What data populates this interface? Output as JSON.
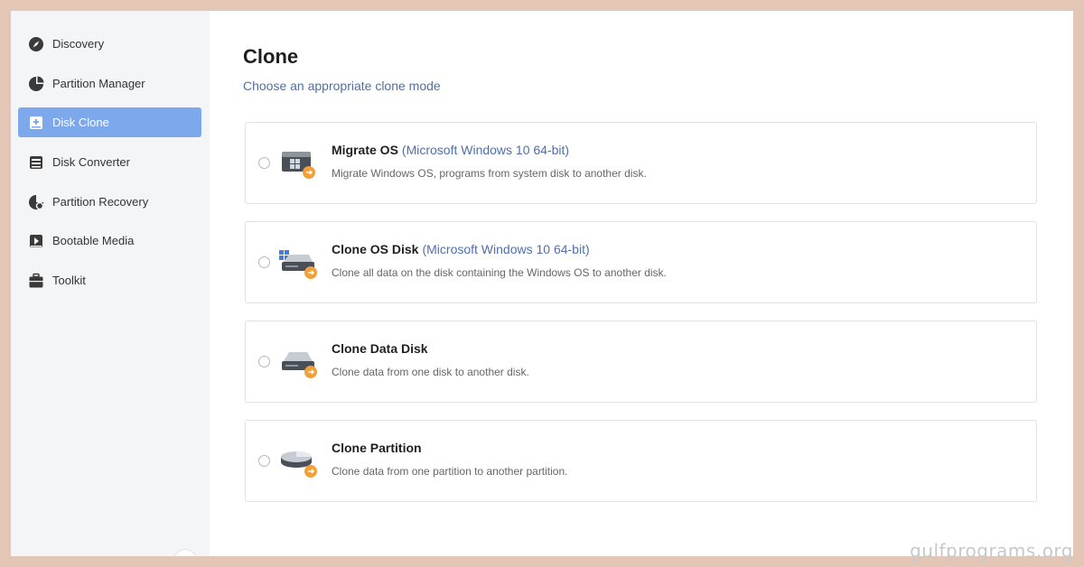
{
  "sidebar": {
    "items": [
      {
        "label": "Discovery",
        "icon": "compass-icon"
      },
      {
        "label": "Partition Manager",
        "icon": "pie-chart-icon"
      },
      {
        "label": "Disk Clone",
        "icon": "disk-clone-icon",
        "active": true
      },
      {
        "label": "Disk Converter",
        "icon": "disk-converter-icon"
      },
      {
        "label": "Partition Recovery",
        "icon": "partition-recovery-icon"
      },
      {
        "label": "Bootable Media",
        "icon": "bootable-media-icon"
      },
      {
        "label": "Toolkit",
        "icon": "toolkit-icon"
      }
    ]
  },
  "main": {
    "title": "Clone",
    "subtitle": "Choose an appropriate clone mode",
    "options": [
      {
        "title": "Migrate OS",
        "os": "(Microsoft Windows 10 64-bit)",
        "desc": "Migrate Windows OS, programs from system disk to another disk.",
        "icon": "migrate-os-icon"
      },
      {
        "title": "Clone OS Disk",
        "os": "(Microsoft Windows 10 64-bit)",
        "desc": "Clone all data on the disk containing the Windows OS to another disk.",
        "icon": "clone-os-disk-icon"
      },
      {
        "title": "Clone Data Disk",
        "os": "",
        "desc": "Clone data from one disk to another disk.",
        "icon": "clone-data-disk-icon"
      },
      {
        "title": "Clone Partition",
        "os": "",
        "desc": "Clone data from one partition to another partition.",
        "icon": "clone-partition-icon"
      }
    ]
  },
  "watermark": "gulfprograms.org",
  "colors": {
    "accent": "#7ea8ec",
    "link": "#4f6fa8",
    "badge": "#f0a13c",
    "frame": "#e4c6b6"
  }
}
